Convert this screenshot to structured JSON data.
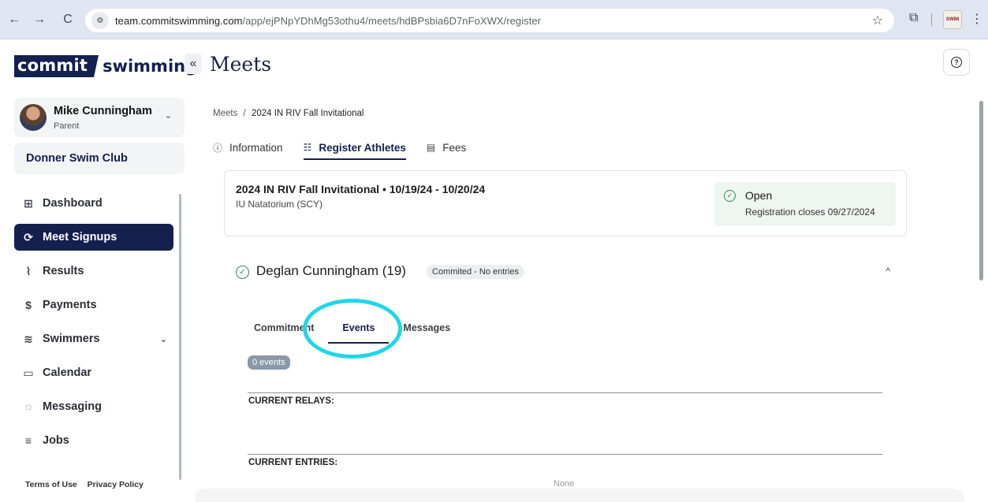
{
  "browser": {
    "url_host": "team.commitswimming.com",
    "url_path": "/app/ejPNpYDhMg53othu4/meets/hdBPsbia6D7nFoXWX/register",
    "icons": [
      "back-arrow-icon",
      "forward-arrow-icon",
      "reload-icon",
      "site-info-icon",
      "bookmark-star-icon",
      "extensions-icon",
      "profile-avatar",
      "more-menu-icon"
    ],
    "profile_text": "SWIM"
  },
  "sidebar": {
    "logo_word1": "commit",
    "logo_word2": "swimming",
    "collapse_glyph": "«",
    "user": {
      "name": "Mike Cunningham",
      "role": "Parent"
    },
    "club": "Donner Swim Club",
    "items": [
      {
        "label": "Dashboard",
        "icon": "grid-icon",
        "glyph": "⊞",
        "active": false
      },
      {
        "label": "Meet Signups",
        "icon": "swimmer-signup-icon",
        "glyph": "⟳",
        "active": true
      },
      {
        "label": "Results",
        "icon": "chart-line-icon",
        "glyph": "⌇",
        "active": false
      },
      {
        "label": "Payments",
        "icon": "dollar-icon",
        "glyph": "$",
        "active": false
      },
      {
        "label": "Swimmers",
        "icon": "swimmer-icon",
        "glyph": "≋",
        "active": false,
        "has_submenu": true
      },
      {
        "label": "Calendar",
        "icon": "calendar-icon",
        "glyph": "▭",
        "active": false
      },
      {
        "label": "Messaging",
        "icon": "chat-bubble-icon",
        "glyph": "◌",
        "active": false
      },
      {
        "label": "Jobs",
        "icon": "document-icon",
        "glyph": "≡",
        "active": false
      }
    ],
    "footer": {
      "terms": "Terms of Use",
      "privacy": "Privacy Policy"
    }
  },
  "main": {
    "title": "Meets",
    "breadcrumb": {
      "root": "Meets",
      "separator": "/",
      "current": "2024 IN RIV Fall Invitational"
    },
    "tabs": [
      {
        "label": "Information",
        "icon": "info-icon",
        "glyph": "ⓘ",
        "active": false
      },
      {
        "label": "Register Athletes",
        "icon": "register-list-icon",
        "glyph": "☷",
        "active": true
      },
      {
        "label": "Fees",
        "icon": "fees-card-icon",
        "glyph": "▤",
        "active": false
      }
    ],
    "meet": {
      "title": "2024 IN RIV Fall Invitational • 10/19/24 - 10/20/24",
      "venue": "IU Natatorium (SCY)",
      "status": "Open",
      "closes": "Registration closes 09/27/2024"
    },
    "athlete": {
      "name": "Deglan Cunningham (19)",
      "badge": "Commited - No entries"
    },
    "subtabs": [
      {
        "label": "Commitment",
        "active": false
      },
      {
        "label": "Events",
        "active": true
      },
      {
        "label": "Messages",
        "active": false
      }
    ],
    "events_count": "0 events",
    "relays_label": "CURRENT RELAYS:",
    "entries_label": "CURRENT ENTRIES:",
    "entries_empty": "None"
  },
  "colors": {
    "brand_navy": "#14204d",
    "success_green": "#2e8b57",
    "highlight_cyan": "#1fd6e8"
  }
}
